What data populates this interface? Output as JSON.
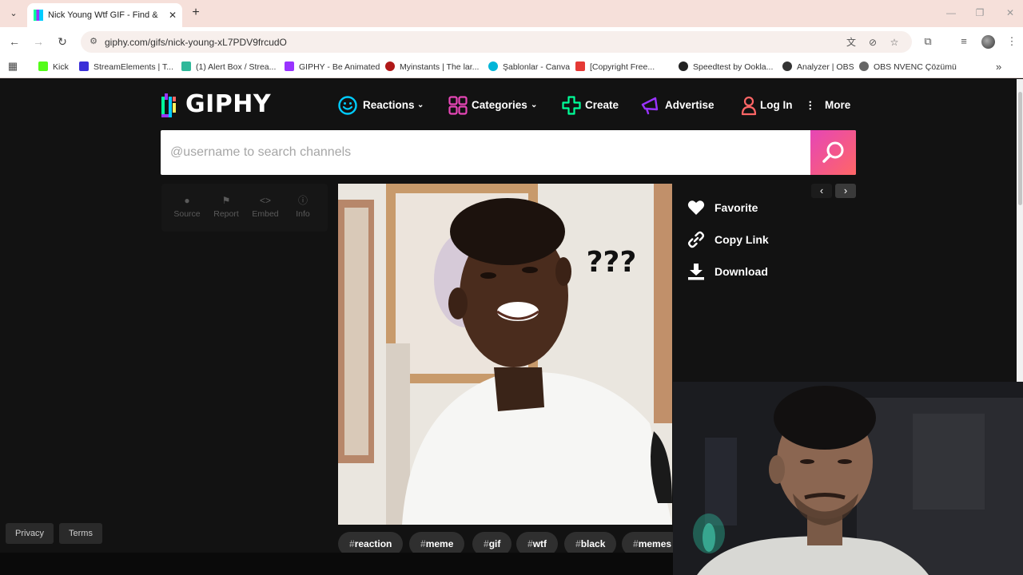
{
  "browser": {
    "tab": {
      "title": "Nick Young Wtf GIF - Find & Sh"
    },
    "url": "giphy.com/gifs/nick-young-xL7PDV9frcudO",
    "bookmarks": [
      {
        "label": "Kick",
        "color": "#53fc18"
      },
      {
        "label": "StreamElements | T...",
        "color": "#3a2fd8"
      },
      {
        "label": "(1) Alert Box / Strea...",
        "color": "#2fb89a"
      },
      {
        "label": "GIPHY - Be Animated",
        "color": "#9933ff"
      },
      {
        "label": "Myinstants | The lar...",
        "color": "#b01818"
      },
      {
        "label": "Şablonlar - Canva",
        "color": "#00b5d8"
      },
      {
        "label": "[Copyright Free...",
        "color": "#e53935"
      },
      {
        "label": "Speedtest by Ookla...",
        "color": "#222222"
      },
      {
        "label": "Analyzer | OBS",
        "color": "#333333"
      },
      {
        "label": "OBS NVENC Çözümü",
        "color": "#666666"
      }
    ]
  },
  "giphy": {
    "logo": "GIPHY",
    "nav": {
      "reactions": "Reactions",
      "categories": "Categories",
      "create": "Create",
      "advertise": "Advertise",
      "login": "Log In",
      "more": "More"
    },
    "search": {
      "placeholder": "@username to search channels"
    },
    "actions": {
      "source": "Source",
      "report": "Report",
      "embed": "Embed",
      "info": "Info"
    },
    "gif": {
      "caption": "???"
    },
    "side": {
      "favorite": "Favorite",
      "copy_link": "Copy Link",
      "download": "Download"
    },
    "tags": [
      "reaction",
      "meme",
      "gif",
      "wtf",
      "black",
      "memes"
    ],
    "footer": {
      "privacy": "Privacy",
      "terms": "Terms"
    }
  },
  "colors": {
    "page_bg": "#121212",
    "search_button": "#e646b6",
    "reactions_icon": "#00ccff",
    "categories_icon": "#e646b6",
    "create_icon": "#00ff99",
    "advertise_icon": "#9933ff",
    "login_icon": "#ff6666"
  }
}
